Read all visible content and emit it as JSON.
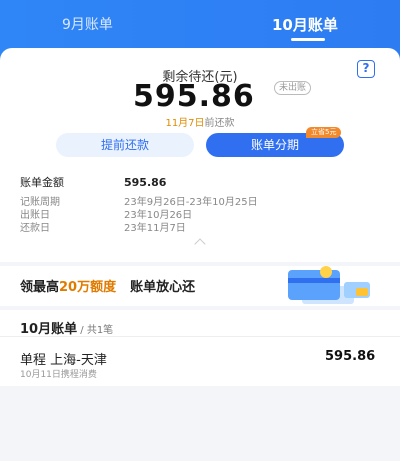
{
  "tabs": [
    {
      "label": "9月账单",
      "active": false
    },
    {
      "label": "10月账单",
      "active": true
    }
  ],
  "summary": {
    "remaining_label": "剩余待还(元)",
    "amount": "595.86",
    "not_billed_badge": "未出账",
    "due_date": "11月7日",
    "due_suffix": "前还款",
    "help_icon": "?"
  },
  "actions": {
    "early_repay": "提前还款",
    "installment": "账单分期",
    "save_badge": "立省5元"
  },
  "details": {
    "bill_amount_label": "账单金额",
    "bill_amount": "595.86",
    "period_label": "记账周期",
    "period": "23年9月26日-23年10月25日",
    "statement_label": "出账日",
    "statement": "23年10月26日",
    "repay_label": "还款日",
    "repay": "23年11月7日"
  },
  "promo": {
    "prefix": "领最高",
    "highlight": "20万额度",
    "suffix": "账单放心还"
  },
  "bill_list": {
    "title": "10月账单",
    "count": " / 共1笔",
    "items": [
      {
        "name": "单程 上海-天津",
        "amount": "595.86",
        "sub": "10月11日携程消费"
      }
    ]
  },
  "colors": {
    "header_blue": "#2f86f6",
    "accent_blue": "#2f6ff0",
    "orange": "#e08b00"
  }
}
